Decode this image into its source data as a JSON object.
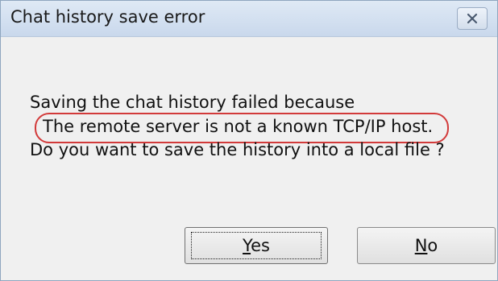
{
  "dialog": {
    "title": "Chat history save error",
    "message_line1": "Saving the chat history failed because",
    "message_line2": "The remote server is not a known TCP/IP host.",
    "message_line3": "Do you want to save the history into a local file ?"
  },
  "buttons": {
    "yes": {
      "mnemonic": "Y",
      "rest": "es"
    },
    "no": {
      "mnemonic": "N",
      "rest": "o"
    }
  },
  "icons": {
    "close": "close-icon"
  },
  "colors": {
    "highlight_ring": "#d23a3a"
  }
}
